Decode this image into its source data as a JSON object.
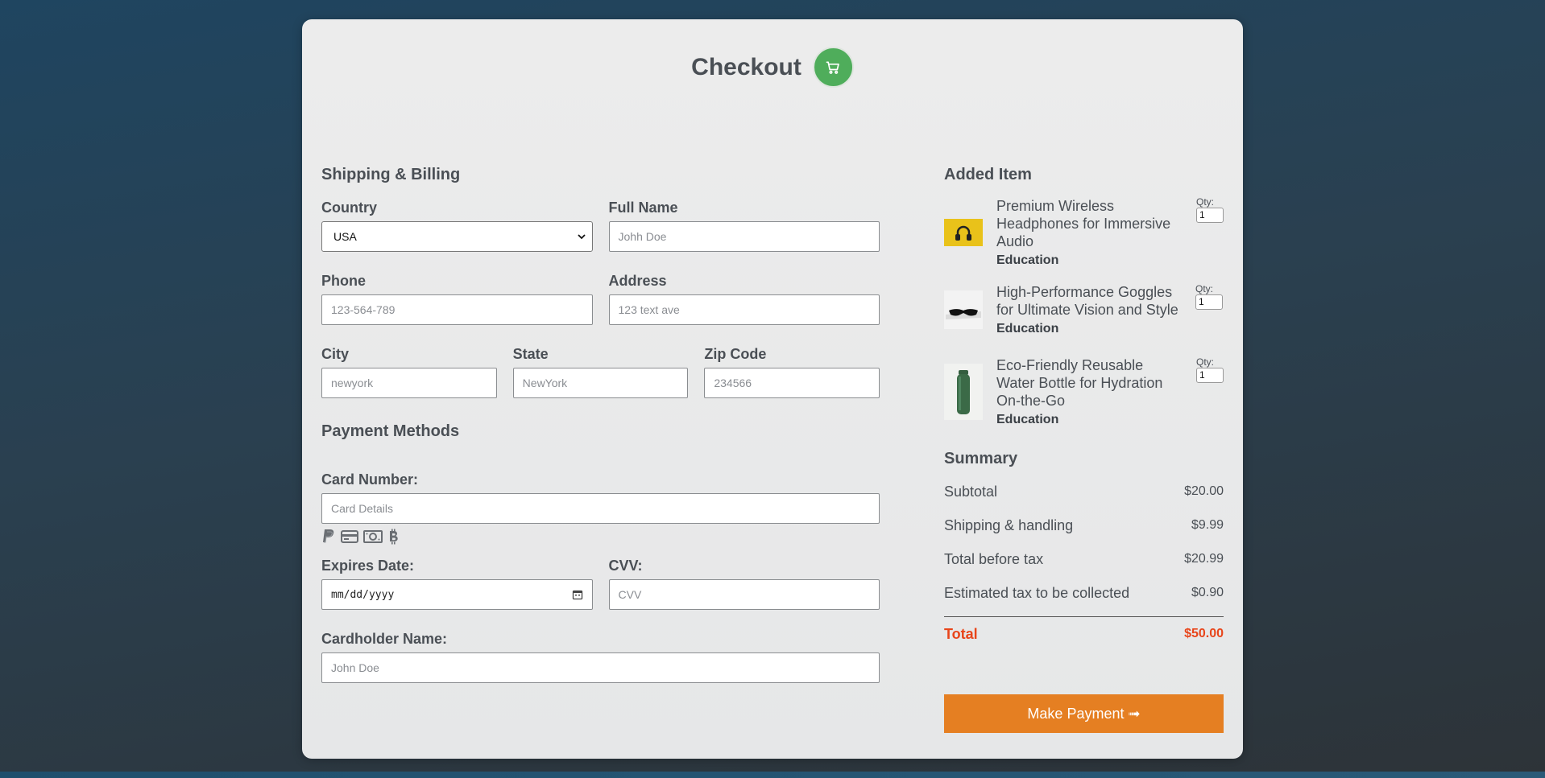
{
  "header": {
    "title": "Checkout",
    "icon": "cart-icon"
  },
  "shipping": {
    "title": "Shipping & Billing",
    "country_label": "Country",
    "country_value": "USA",
    "fullname_label": "Full Name",
    "fullname_placeholder": "Johh Doe",
    "phone_label": "Phone",
    "phone_placeholder": "123-564-789",
    "address_label": "Address",
    "address_placeholder": "123 text ave",
    "city_label": "City",
    "city_placeholder": "newyork",
    "state_label": "State",
    "state_placeholder": "NewYork",
    "zip_label": "Zip Code",
    "zip_placeholder": "234566"
  },
  "payment": {
    "title": "Payment Methods",
    "card_label": "Card Number:",
    "card_placeholder": "Card Details",
    "methods": [
      "paypal-icon",
      "credit-card-icon",
      "cash-icon",
      "bitcoin-icon"
    ],
    "expires_label": "Expires Date:",
    "expires_placeholder": "mm/dd/yyyy",
    "cvv_label": "CVV:",
    "cvv_placeholder": "CVV",
    "holder_label": "Cardholder Name:",
    "holder_placeholder": "John Doe"
  },
  "cart": {
    "title": "Added Item",
    "qty_label": "Qty:",
    "items": [
      {
        "title": "Premium Wireless Headphones for Immersive Audio",
        "category": "Education",
        "qty": "1"
      },
      {
        "title": "High-Performance Goggles for Ultimate Vision and Style",
        "category": "Education",
        "qty": "1"
      },
      {
        "title": "Eco-Friendly Reusable Water Bottle for Hydration On-the-Go",
        "category": "Education",
        "qty": "1"
      }
    ]
  },
  "summary": {
    "title": "Summary",
    "rows": [
      {
        "label": "Subtotal",
        "value": "$20.00"
      },
      {
        "label": "Shipping & handling",
        "value": "$9.99"
      },
      {
        "label": "Total before tax",
        "value": "$20.99"
      },
      {
        "label": "Estimated tax to be collected",
        "value": "$0.90"
      }
    ],
    "total_label": "Total",
    "total_value": "$50.00"
  },
  "action": {
    "pay_label": "Make Payment ➟"
  },
  "colors": {
    "accent": "#e57f22",
    "total": "#e8451a",
    "cart_badge": "#4fad5b"
  }
}
